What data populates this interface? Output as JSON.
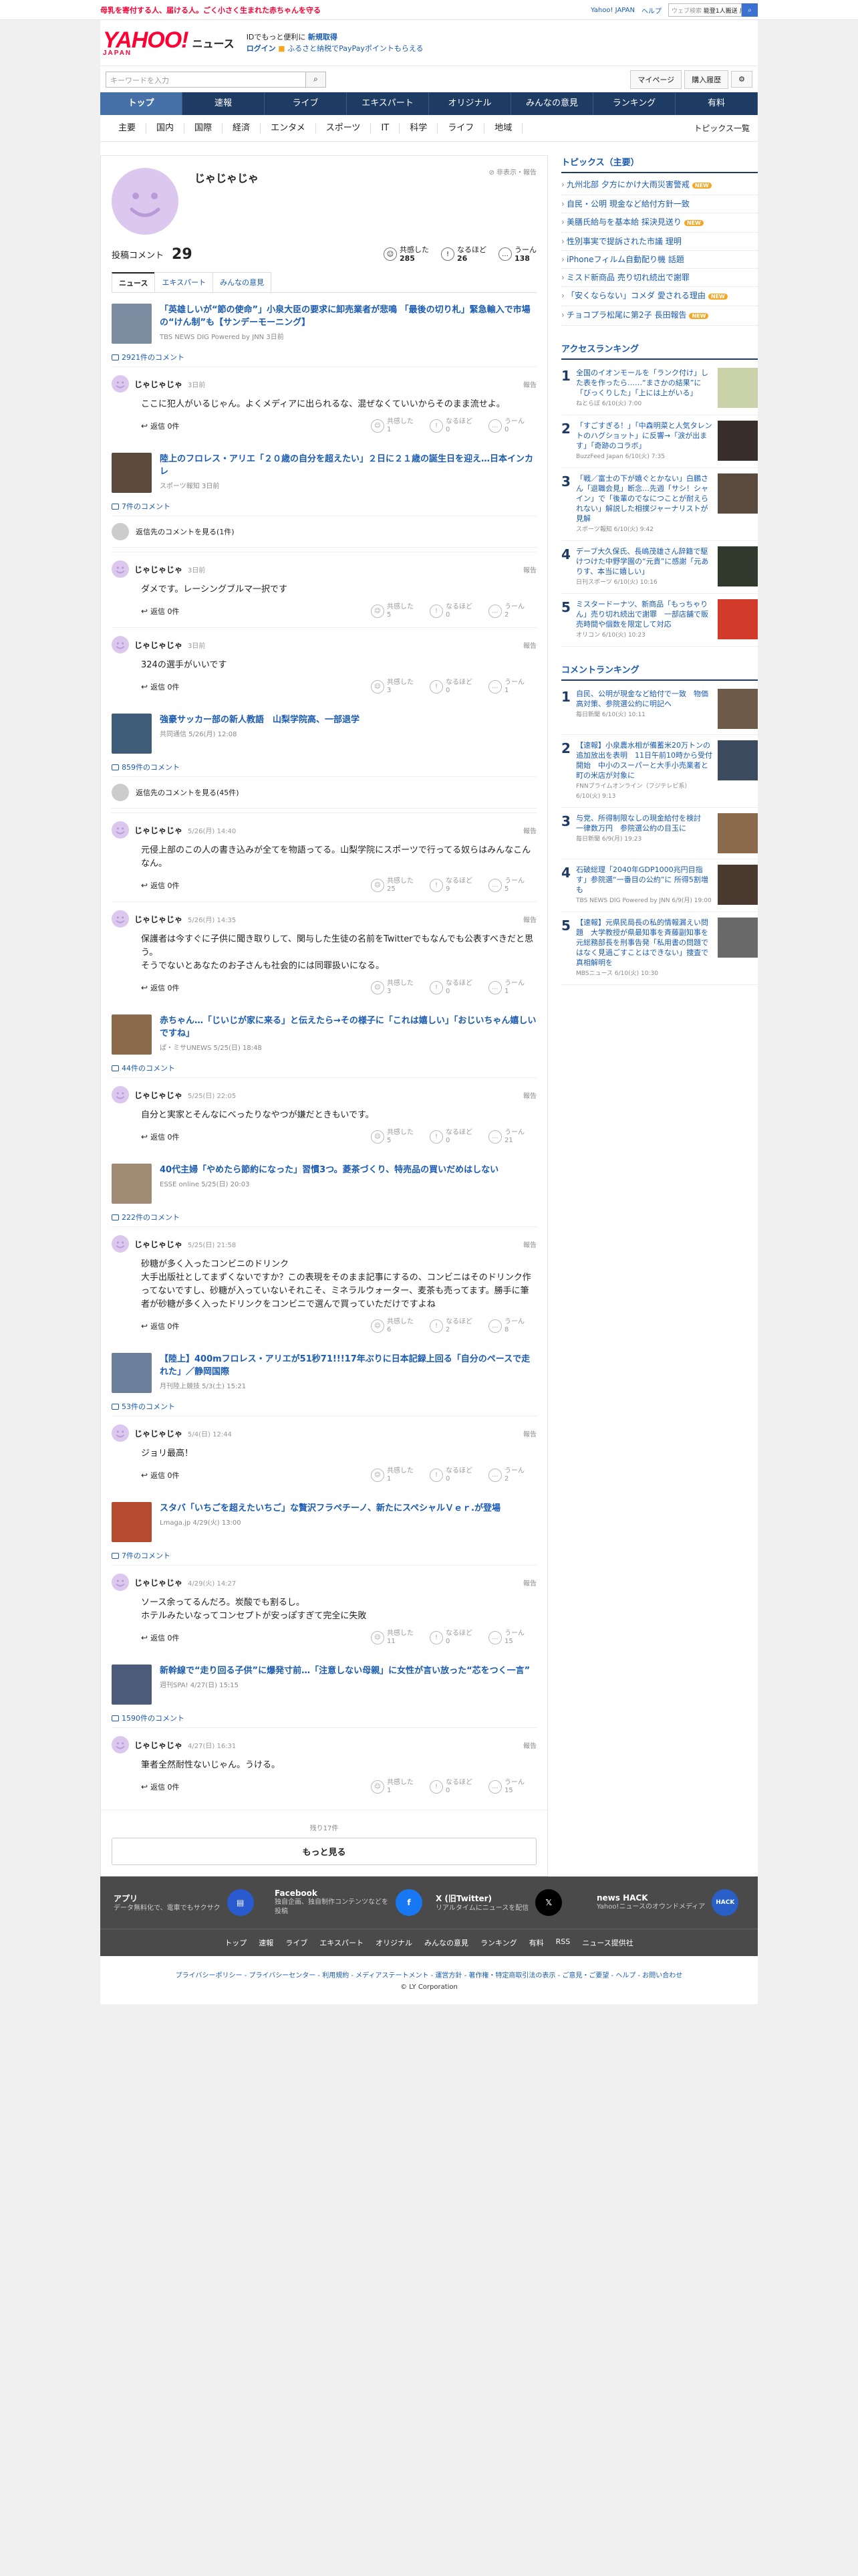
{
  "topbar": {
    "promo": "母乳を寄付する人、届ける人。ごく小さく生まれた赤ちゃんを守る",
    "links": [
      "Yahoo! JAPAN",
      "ヘルプ"
    ],
    "search_placeholder": "ウェブ検索",
    "search_value": "能登1人搬送 川..."
  },
  "header": {
    "logo": "YAHOO!",
    "logo_sub": "JAPAN",
    "news": "ニュース",
    "promo1": "IDでもっと便利に",
    "promo1b": "新規取得",
    "login": "ログイン",
    "promo2": "ふるさと納税でPayPayポイントもらえる"
  },
  "search": {
    "placeholder": "キーワードを入力",
    "mypage": "マイページ",
    "history": "購入履歴"
  },
  "gnav": [
    "トップ",
    "速報",
    "ライブ",
    "エキスパート",
    "オリジナル",
    "みんなの意見",
    "ランキング",
    "有料"
  ],
  "snav": [
    "主要",
    "国内",
    "国際",
    "経済",
    "エンタメ",
    "スポーツ",
    "IT",
    "科学",
    "ライフ",
    "地域"
  ],
  "snav_topics": "トピックス一覧",
  "profile": {
    "name": "じゃじゃじゃ",
    "hide": "非表示・報告",
    "count_label": "投稿コメント",
    "count": "29",
    "reactions": [
      {
        "label": "共感した",
        "value": "285",
        "icon": "☺"
      },
      {
        "label": "なるほど",
        "value": "26",
        "icon": "!"
      },
      {
        "label": "うーん",
        "value": "138",
        "icon": "…"
      }
    ]
  },
  "tabs": [
    "ニュース",
    "エキスパート",
    "みんなの意見"
  ],
  "rx_labels": [
    "共感した",
    "なるほど",
    "うーん"
  ],
  "reply_label": "返信 0件",
  "report": "報告",
  "articles": [
    {
      "title": "「英雄しいが“節の使命”」小泉大臣の要求に卸売業者が悲鳴 「最後の切り札」緊急輸入で市場の“けん制”も【サンデーモーニング】",
      "src": "TBS NEWS DIG Powered by JNN 3日前",
      "count": "2921件のコメント",
      "thumb": "#7a8ca0",
      "comments": [
        {
          "date": "3日前",
          "body": "ここに犯人がいるじゃん。よくメディアに出られるな、混ぜなくていいからそのまま流せよ。",
          "rx": [
            "1",
            "0",
            "0"
          ]
        }
      ]
    },
    {
      "title": "陸上のフロレス・アリエ「２０歳の自分を超えたい」２日に２１歳の誕生日を迎え…日本インカレ",
      "src": "スポーツ報知 3日前",
      "count": "7件のコメント",
      "thumb": "#5b4a3a",
      "reply_prev": "返信先のコメントを見る(1件)",
      "comments": [
        {
          "date": "3日前",
          "body": "ダメです。レーシングブルマ一択です",
          "rx": [
            "5",
            "0",
            "2"
          ]
        },
        {
          "date": "3日前",
          "body": "324の選手がいいです",
          "rx": [
            "3",
            "0",
            "1"
          ]
        }
      ]
    },
    {
      "title": "強豪サッカー部の新人教語　山梨学院高、一部退学",
      "src": "共同通信 5/26(月) 12:08",
      "count": "859件のコメント",
      "thumb": "#3e5d7a",
      "reply_prev": "返信先のコメントを見る(45件)",
      "comments": [
        {
          "date": "5/26(月) 14:40",
          "body": "元侵上部のこの人の書き込みが全てを物語ってる。山梨学院にスポーツで行ってる奴らはみんなこんなん。",
          "rx": [
            "25",
            "9",
            "5"
          ]
        },
        {
          "date": "5/26(月) 14:35",
          "body": "保護者は今すぐに子供に聞き取りして、関与した生徒の名前をTwitterでもなんでも公表すべきだと思う。\nそうでないとあなたのお子さんも社会的には同罪扱いになる。",
          "rx": [
            "3",
            "0",
            "1"
          ]
        }
      ]
    },
    {
      "title": "赤ちゃん…「じいじが家に来る」と伝えたら→その様子に「これは嬉しい」「おじいちゃん嬉しいですね」",
      "src": "ぱ・ミサUNEWS 5/25(日) 18:48",
      "count": "44件のコメント",
      "thumb": "#8a6a4a",
      "comments": [
        {
          "date": "5/25(日) 22:05",
          "body": "自分と実家とそんなにべったりなやつが嫌だときもいです。",
          "rx": [
            "5",
            "0",
            "21"
          ]
        }
      ]
    },
    {
      "title": "40代主婦「やめたら節約になった」習慣3つ。菱茶づくり、特売品の買いだめはしない",
      "src": "ESSE online 5/25(日) 20:03",
      "count": "222件のコメント",
      "thumb": "#a08c74",
      "comments": [
        {
          "date": "5/25(日) 21:58",
          "body": "砂糖が多く入ったコンビニのドリンク\n大手出版社としてまずくないですか？この表現をそのまま記事にするの、コンビニはそのドリンク作ってないですし、砂糖が入っていないそれこそ、ミネラルウォーター、麦茶も売ってます。勝手に筆者が砂糖が多く入ったドリンクをコンビニで選んで買っていただけですよね",
          "rx": [
            "6",
            "2",
            "8"
          ]
        }
      ]
    },
    {
      "title": "【陸上】400mフロレス・アリエが51秒71!!!17年ぶりに日本記録上回る「自分のペースで走れた」／静岡国際",
      "src": "月刊陸上競技 5/3(土) 15:21",
      "count": "53件のコメント",
      "thumb": "#6b7f9a",
      "comments": [
        {
          "date": "5/4(日) 12:44",
          "body": "ジョリ最高！",
          "rx": [
            "1",
            "0",
            "2"
          ]
        }
      ]
    },
    {
      "title": "スタバ「いちごを超えたいちご」な贅沢フラペチーノ、新たにスペシャルＶｅｒ.が登場",
      "src": "Lmaga.jp 4/29(火) 13:00",
      "count": "7件のコメント",
      "thumb": "#b54a2e",
      "comments": [
        {
          "date": "4/29(火) 14:27",
          "body": "ソース余ってるんだろ。炭酸でも割るし。\nホテルみたいなってコンセプトが安っぽすぎて完全に失敗",
          "rx": [
            "11",
            "0",
            "15"
          ]
        }
      ]
    },
    {
      "title": "新幹線で“走り回る子供”に爆発寸前…「注意しない母親」に女性が言い放った“芯をつく一言”",
      "src": "週刊SPA! 4/27(日) 15:15",
      "count": "1590件のコメント",
      "thumb": "#4a5c7a",
      "comments": [
        {
          "date": "4/27(日) 16:31",
          "body": "筆者全然耐性ないじゃん。うける。",
          "rx": [
            "1",
            "0",
            "15"
          ]
        }
      ]
    }
  ],
  "more": {
    "remaining": "残り17件",
    "button": "もっと見る"
  },
  "side": {
    "topics_title": "トピックス（主要）",
    "topics": [
      {
        "t": "九州北部 夕方にかけ大雨災害警戒",
        "n": true
      },
      {
        "t": "自民・公明 現金など給付方針一致",
        "n": false
      },
      {
        "t": "美膳氏給与を基本給 採決見送り",
        "n": true
      },
      {
        "t": "性別事実で提訴された市議 理明",
        "n": false
      },
      {
        "t": "iPhoneフィルム自動配り機 話題",
        "n": false
      },
      {
        "t": "ミスド新商品 売り切れ続出で謝罪",
        "n": false
      },
      {
        "t": "「安くならない」コメダ 愛される理由",
        "n": true
      },
      {
        "t": "チョコプラ松尾に第2子 長田報告",
        "n": true
      }
    ],
    "rank_title": "アクセスランキング",
    "access": [
      {
        "t": "全国のイオンモールを「ランク付け」した表を作ったら……“まさかの結果”に「びっくりした」「上には上がいる」",
        "m": "ねとらぼ 6/10(火) 7:00",
        "c": "#c9d2a8"
      },
      {
        "t": "「すごすぎる！」「中森明菜と人気タレントのハグショット」に反響→「涙が出ます」「奇跡のコラボ」",
        "m": "BuzzFeed Japan 6/10(火) 7:35",
        "c": "#3a2e2a"
      },
      {
        "t": "「戦／富士の下が嬉ぐとかない」白鵬さん「退職会見」断念…先週「サシ！シャイン」で「後輩のでなにつことが耐えられない」解説した相撲ジャーナリストが見解",
        "m": "スポーツ報知 6/10(火) 9:42",
        "c": "#5a4a3e"
      },
      {
        "t": "デーブ大久保氏、長嶋茂雄さん辞籍で駆けつけた中野学園の“元貴”に感謝「元ありす、本当に嬉しい」",
        "m": "日刊スポーツ 6/10(火) 10:16",
        "c": "#2f3a2c"
      },
      {
        "t": "ミスタードーナツ、新商品「もっちゃりん」売り切れ続出で謝罪　一部店舗で販売時間や個数を限定して対応",
        "m": "オリコン 6/10(火) 10:23",
        "c": "#d23a2a"
      }
    ],
    "comment_title": "コメントランキング",
    "comment_rank": [
      {
        "t": "自民、公明が現金など給付で一致　物価高対策、参院選公約に明記へ",
        "m": "毎日新聞 6/10(火) 10:11",
        "c": "#6d5a48"
      },
      {
        "t": "【速報】小泉農水相が備蓄米20万トンの追加放出を表明　11日午前10時から受付開始　中小のスーパーと大手小売業者と町の米店が対象に",
        "m": "FNNプライムオンライン（フジテレビ系） 6/10(火) 9:13",
        "c": "#3b4a5e"
      },
      {
        "t": "与党、所得制限なしの現金給付を検討　一律数万円　参院選公約の目玉に",
        "m": "毎日新聞 6/9(月) 19:23",
        "c": "#8a6a4a"
      },
      {
        "t": "石破総理「2040年GDP1000兆円目指す」参院選“一番目の公約”に 所得5割増も",
        "m": "TBS NEWS DIG Powered by JNN 6/9(月) 19:00",
        "c": "#4a3a30"
      },
      {
        "t": "【速報】元県民局長の私的情報漏えい問題　大学教授が県最知事を斉藤副知事を 元総務部長を刑事告発「私用書の問題ではなく見過ごすことはできない」捜査で真相解明を",
        "m": "MBSニュース 6/10(火) 10:30",
        "c": "#6a6a6a"
      }
    ]
  },
  "footer": {
    "apps": [
      {
        "t": "アプリ",
        "d": "データ無料化で、電車でもサクサク",
        "lg": "#2a5ad0",
        "ic": "▤"
      },
      {
        "t": "Facebook",
        "d": "独自企画、独自制作コンテンツなどを投稿",
        "lg": "#1877f2",
        "ic": "f"
      },
      {
        "t": "X (旧Twitter)",
        "d": "リアルタイムにニュースを配信",
        "lg": "#000000",
        "ic": "𝕏"
      },
      {
        "t": "news HACK",
        "d": "Yahoo!ニュースのオウンドメディア",
        "lg": "#2860c8",
        "ic": "HACK"
      }
    ],
    "links": [
      "トップ",
      "速報",
      "ライブ",
      "エキスパート",
      "オリジナル",
      "みんなの意見",
      "ランキング",
      "有料",
      "RSS",
      "ニュース提供社"
    ],
    "legal": "プライバシーポリシー - プライバシーセンター - 利用規約 - メディアステートメント - 運営方針 - 著作権・特定商取引法の表示 - ご意見・ご要望 - ヘルプ - お問い合わせ",
    "copy": "© LY Corporation"
  }
}
